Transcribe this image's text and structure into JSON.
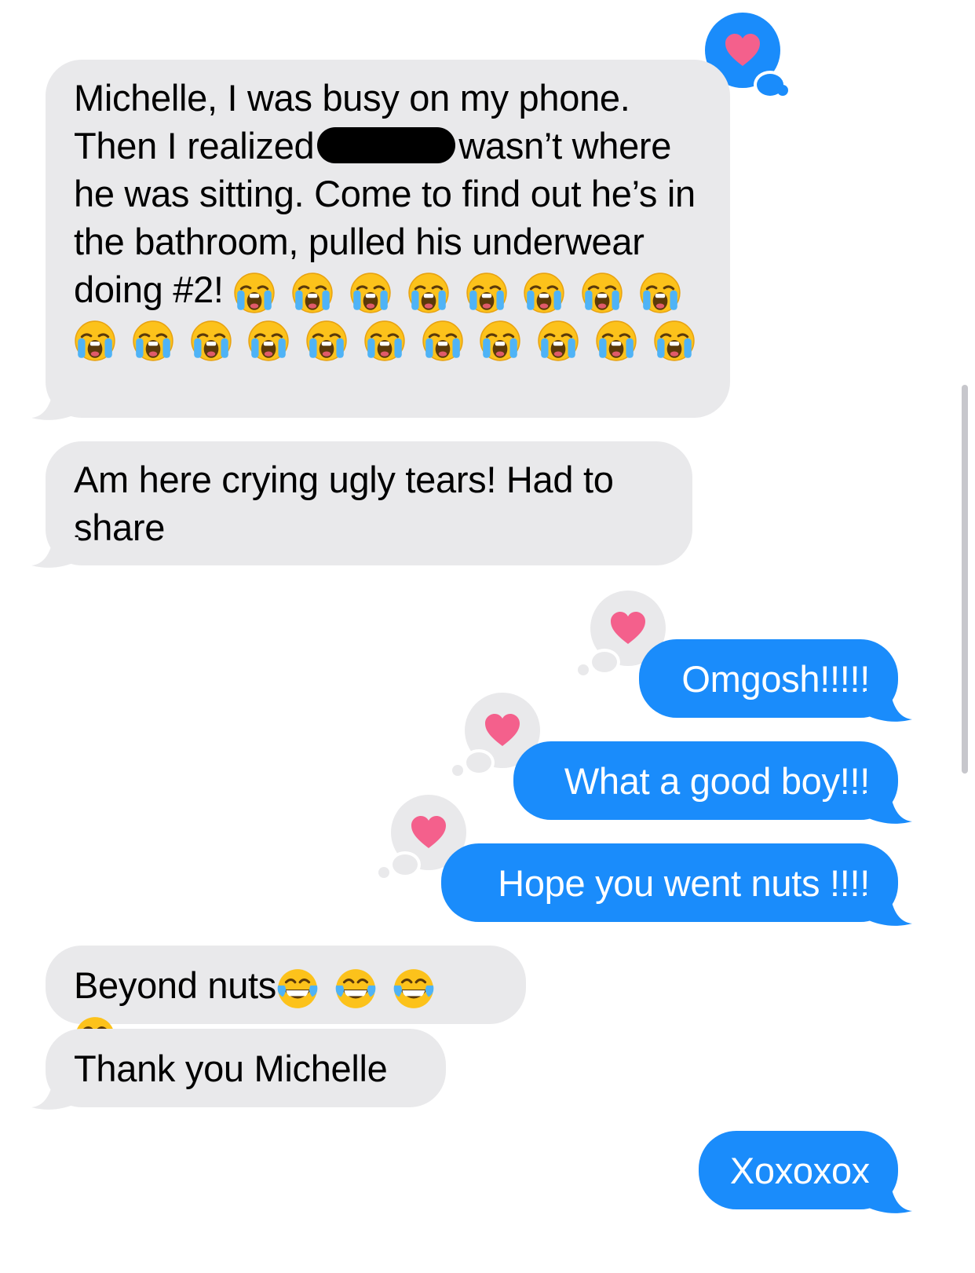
{
  "messages": [
    {
      "id": "m1",
      "from": "received",
      "text_parts": [
        "Michelle, I was busy on my phone. Then I realized",
        "wasn’t where he was sitting. Come to find out he’s in the bathroom, pulled his underwear doing #2!"
      ],
      "emoji": "loudly-crying-face",
      "emoji_count": 19,
      "redacted": true,
      "reaction": "heart"
    },
    {
      "id": "m2",
      "from": "received",
      "text": "Am here crying ugly tears! Had to share"
    },
    {
      "id": "m3",
      "from": "sent",
      "text": "Omgosh!!!!!",
      "reaction": "heart"
    },
    {
      "id": "m4",
      "from": "sent",
      "text": "What a good boy!!!",
      "reaction": "heart"
    },
    {
      "id": "m5",
      "from": "sent",
      "text": "Hope you went nuts !!!!",
      "reaction": "heart"
    },
    {
      "id": "m6",
      "from": "received",
      "text": "Beyond nuts",
      "emoji": "face-with-tears-of-joy",
      "emoji_count": 4
    },
    {
      "id": "m7",
      "from": "received",
      "text": "Thank you Michelle"
    },
    {
      "id": "m8",
      "from": "sent",
      "text": "Xoxoxox"
    }
  ],
  "colors": {
    "received_bubble": "#e9e9eb",
    "sent_bubble": "#1a8cfb",
    "heart": "#f4608c",
    "tapback_blue": "#2b9cf6"
  }
}
